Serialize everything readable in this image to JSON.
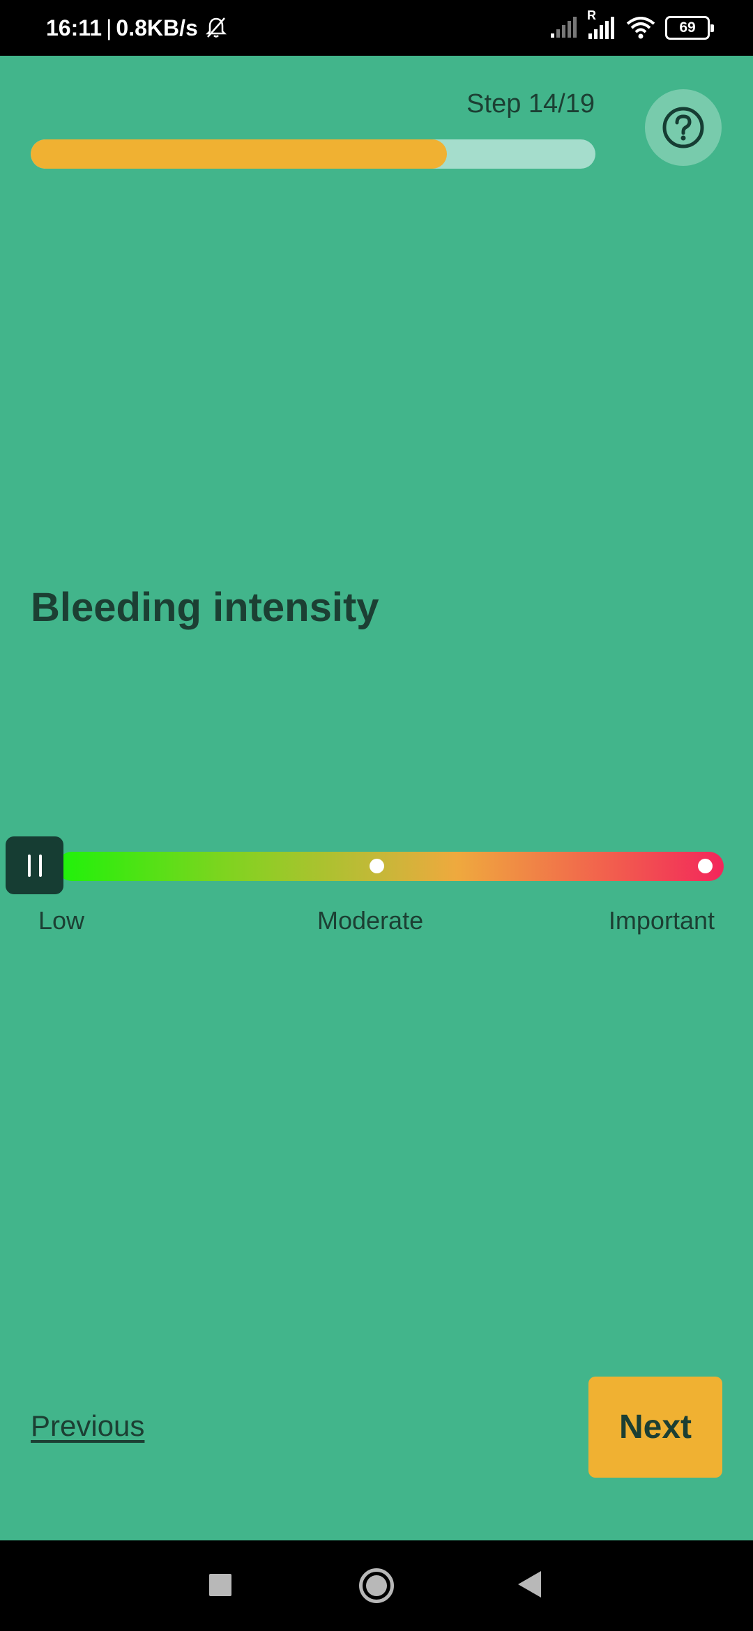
{
  "status_bar": {
    "time": "16:11",
    "separator": "|",
    "network_speed": "0.8KB/s",
    "icons": [
      "bell-muted-icon",
      "signal-weak-icon",
      "signal-roaming-icon",
      "wifi-icon",
      "battery-icon"
    ],
    "roaming_label": "R",
    "battery_level": "69"
  },
  "header": {
    "step_label": "Step 14/19",
    "progress_fraction": 0.737,
    "help_icon": "question-circle-icon"
  },
  "question": {
    "title": "Bleeding intensity"
  },
  "slider": {
    "value_fraction": 0,
    "labels": {
      "low": "Low",
      "moderate": "Moderate",
      "important": "Important"
    },
    "stop_markers": [
      0.5,
      1.0
    ]
  },
  "footer": {
    "previous_label": "Previous",
    "next_label": "Next"
  },
  "colors": {
    "background": "#42b58b",
    "accent": "#f0b132",
    "text_dark": "#1c3f33",
    "thumb": "#163d33"
  }
}
